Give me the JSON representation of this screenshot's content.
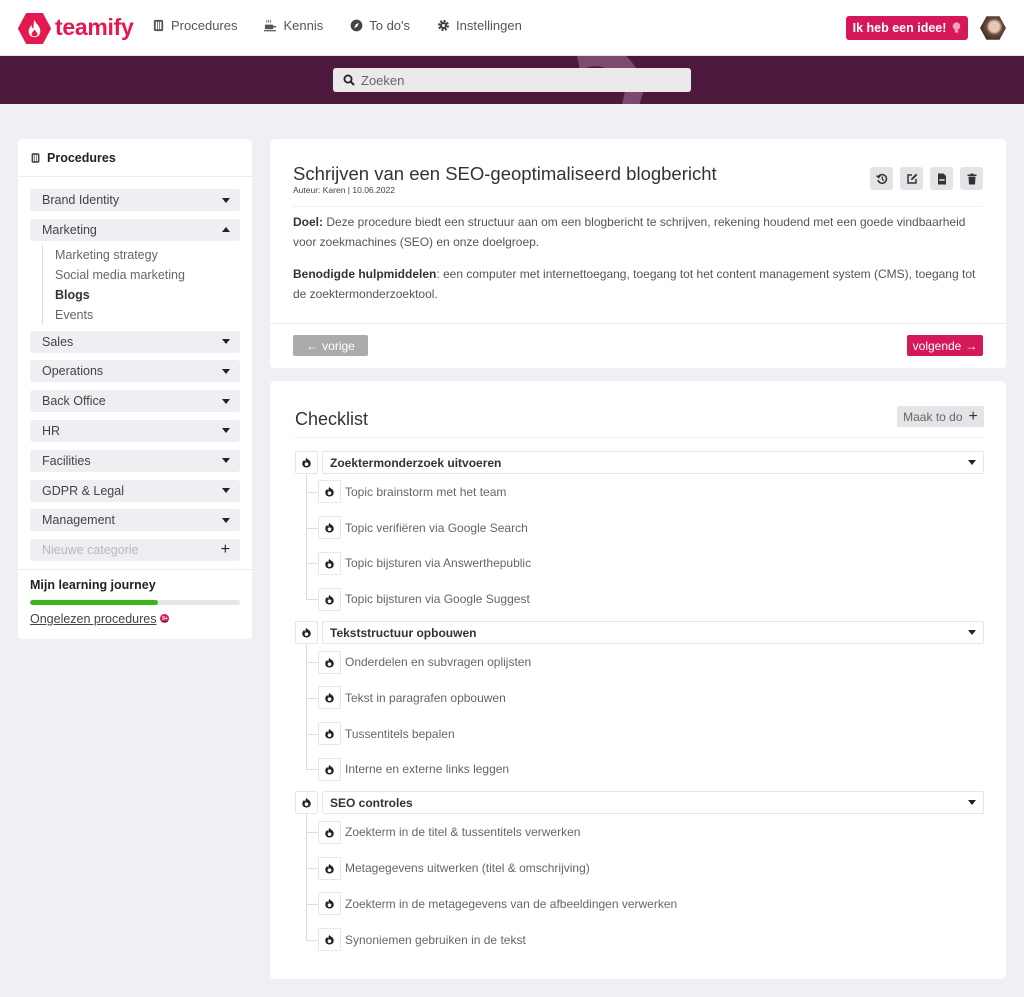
{
  "brand": {
    "name": "teamify",
    "accent": "#e3194f",
    "banner": "#4b1a3d"
  },
  "nav": [
    {
      "label": "Procedures",
      "icon": "building-icon"
    },
    {
      "label": "Kennis",
      "icon": "coffee-icon"
    },
    {
      "label": "To do's",
      "icon": "compass-icon"
    },
    {
      "label": "Instellingen",
      "icon": "gear-icon"
    }
  ],
  "header": {
    "idea_button": "Ik heb een idee!",
    "idea_icon": "lightbulb-icon"
  },
  "search": {
    "placeholder": "Zoeken"
  },
  "sidebar": {
    "title": "Procedures",
    "categories": [
      {
        "label": "Brand Identity",
        "expanded": false
      },
      {
        "label": "Marketing",
        "expanded": true,
        "children": [
          "Marketing strategy",
          "Social media marketing",
          "Blogs",
          "Events"
        ],
        "active_child": "Blogs"
      },
      {
        "label": "Sales",
        "expanded": false
      },
      {
        "label": "Operations",
        "expanded": false
      },
      {
        "label": "Back Office",
        "expanded": false
      },
      {
        "label": "HR",
        "expanded": false
      },
      {
        "label": "Facilities",
        "expanded": false
      },
      {
        "label": "GDPR & Legal",
        "expanded": false
      },
      {
        "label": "Management",
        "expanded": false
      }
    ],
    "new_category_placeholder": "Nieuwe categorie",
    "learning_journey": {
      "title": "Mijn learning journey",
      "progress_percent": 61,
      "unread_label": "Ongelezen procedures",
      "unread_badge": "9+"
    }
  },
  "procedure": {
    "title": "Schrijven van een SEO-geoptimaliseerd blogbericht",
    "meta": "Auteur: Karen | 10.06.2022",
    "goal_label": "Doel:",
    "goal_text": " Deze procedure biedt een structuur aan om een blogbericht te schrijven, rekening houdend met een goede vindbaarheid voor zoekmachines (SEO) en onze doelgroep.",
    "tools_label": "Benodigde hulpmiddelen",
    "tools_text": ": een computer met internettoegang, toegang tot het content management system (CMS), toegang tot de zoektermonderzoektool.",
    "actions": [
      "history-icon",
      "edit-icon",
      "pdf-icon",
      "trash-icon"
    ],
    "prev_label": "vorige",
    "next_label": "volgende"
  },
  "checklist": {
    "title": "Checklist",
    "make_todo": "Maak to do",
    "groups": [
      {
        "title": "Zoektermonderzoek uitvoeren",
        "items": [
          "Topic brainstorm met het team",
          "Topic verifiëren via Google Search",
          "Topic bijsturen via Answerthepublic",
          "Topic bijsturen via Google Suggest"
        ]
      },
      {
        "title": "Tekststructuur opbouwen",
        "items": [
          "Onderdelen en subvragen oplijsten",
          "Tekst in paragrafen opbouwen",
          "Tussentitels bepalen",
          "Interne en externe links leggen"
        ]
      },
      {
        "title": "SEO controles",
        "items": [
          "Zoekterm in de titel & tussentitels verwerken",
          "Metagegevens uitwerken (titel & omschrijving)",
          "Zoekterm in de metagegevens van de afbeeldingen verwerken",
          "Synoniemen gebruiken in de tekst"
        ]
      }
    ]
  }
}
